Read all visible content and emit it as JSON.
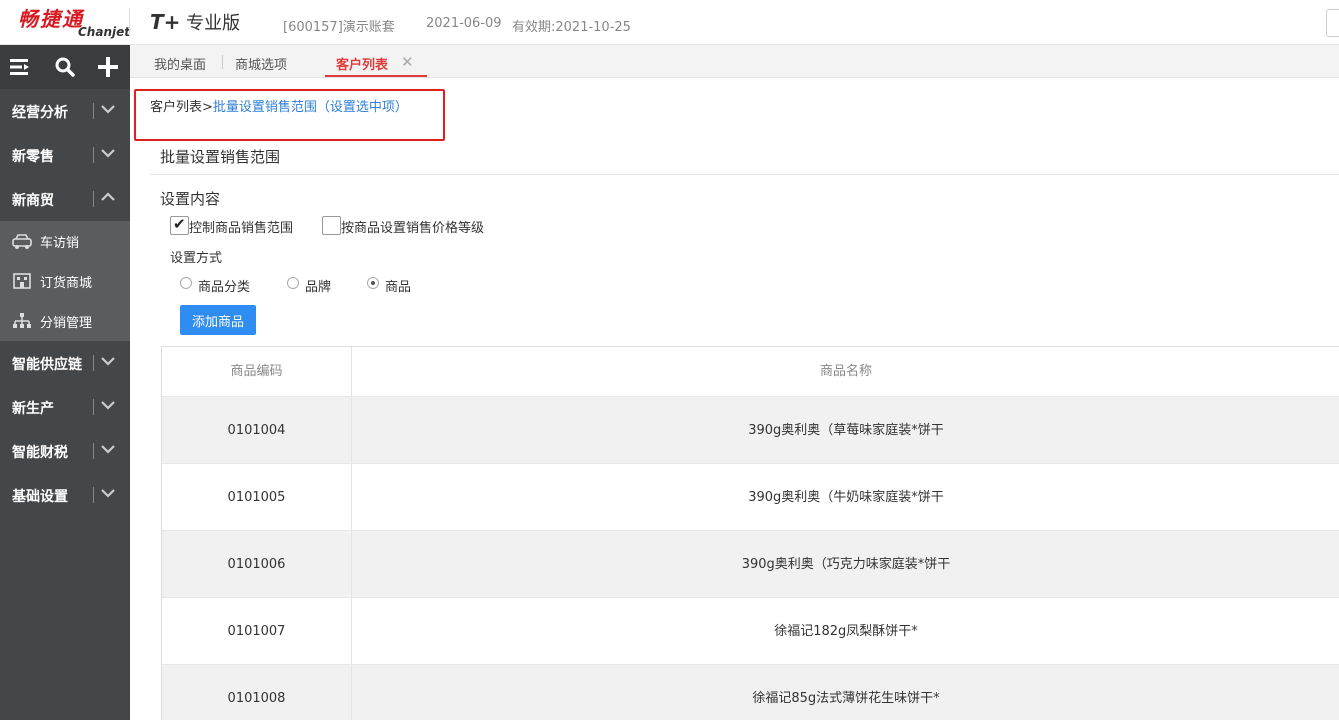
{
  "header": {
    "logo_cn": "畅捷通",
    "logo_en": "Chanjet",
    "product_prefix": "T+",
    "product_name": "专业版",
    "account": "[600157]演示账套",
    "date": "2021-06-09",
    "expiry": "有效期:2021-10-25"
  },
  "sidebar": {
    "tools": [
      "menu-icon",
      "search-icon",
      "plus-icon"
    ],
    "menus": [
      {
        "label": "经营分析",
        "expanded": false
      },
      {
        "label": "新零售",
        "expanded": false
      },
      {
        "label": "新商贸",
        "expanded": true
      }
    ],
    "sub_items": [
      {
        "label": "车访销",
        "icon": "car-icon"
      },
      {
        "label": "订货商城",
        "icon": "store-icon"
      },
      {
        "label": "分销管理",
        "icon": "org-chart-icon"
      }
    ],
    "menus_after": [
      {
        "label": "智能供应链"
      },
      {
        "label": "新生产"
      },
      {
        "label": "智能财税"
      },
      {
        "label": "基础设置"
      }
    ]
  },
  "tabs": [
    {
      "label": "我的桌面"
    },
    {
      "label": "商城选项"
    },
    {
      "label": "客户列表",
      "active": true
    }
  ],
  "breadcrumb": {
    "root": "客户列表",
    "separator": ">",
    "current": "批量设置销售范围（设置选中项）"
  },
  "form": {
    "section_title": "批量设置销售范围",
    "content_title": "设置内容",
    "checkbox_control_range": {
      "label": "控制商品销售范围",
      "checked": true
    },
    "checkbox_price_level": {
      "label": "按商品设置销售价格等级",
      "checked": false
    },
    "method_label": "设置方式",
    "radios": [
      {
        "label": "商品分类",
        "selected": false
      },
      {
        "label": "品牌",
        "selected": false
      },
      {
        "label": "商品",
        "selected": true
      }
    ],
    "add_button": "添加商品"
  },
  "table": {
    "headers": {
      "code": "商品编码",
      "name": "商品名称"
    },
    "rows": [
      {
        "code": "0101004",
        "name": "390g奥利奥（草莓味家庭装*饼干"
      },
      {
        "code": "0101005",
        "name": "390g奥利奥（牛奶味家庭装*饼干"
      },
      {
        "code": "0101006",
        "name": "390g奥利奥（巧克力味家庭装*饼干"
      },
      {
        "code": "0101007",
        "name": "徐福记182g凤梨酥饼干*"
      },
      {
        "code": "0101008",
        "name": "徐福记85g法式薄饼花生味饼干*"
      }
    ]
  },
  "colors": {
    "brand_red": "#d71a21",
    "sidebar_bg": "#444749",
    "accent_blue": "#2f8cf0",
    "active_tab": "#e03b3b",
    "highlight_border": "#e02020"
  }
}
